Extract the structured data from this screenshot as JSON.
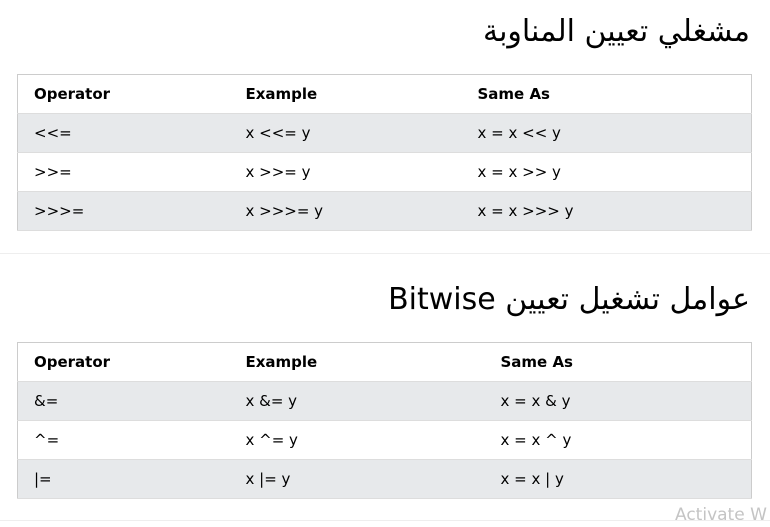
{
  "shift_section": {
    "title": "مشغلي تعيين المناوبة",
    "headers": [
      "Operator",
      "Example",
      "Same As"
    ],
    "rows": [
      [
        "<<=",
        "x <<= y",
        "x = x << y"
      ],
      [
        ">>=",
        "x >>= y",
        "x = x >> y"
      ],
      [
        ">>>=",
        "x >>>= y",
        "x = x >>> y"
      ]
    ]
  },
  "bitwise_section": {
    "title": "عوامل تشغيل تعيين Bitwise",
    "headers": [
      "Operator",
      "Example",
      "Same As"
    ],
    "rows": [
      [
        "&=",
        "x &= y",
        "x = x & y"
      ],
      [
        "^=",
        "x ^= y",
        "x = x ^ y"
      ],
      [
        "|=",
        "x |= y",
        "x = x | y"
      ]
    ]
  },
  "watermark": "Activate W",
  "colors": {
    "shaded_row": "#e7e9eb",
    "border": "#cccccc",
    "watermark": "#c4c4c4"
  }
}
